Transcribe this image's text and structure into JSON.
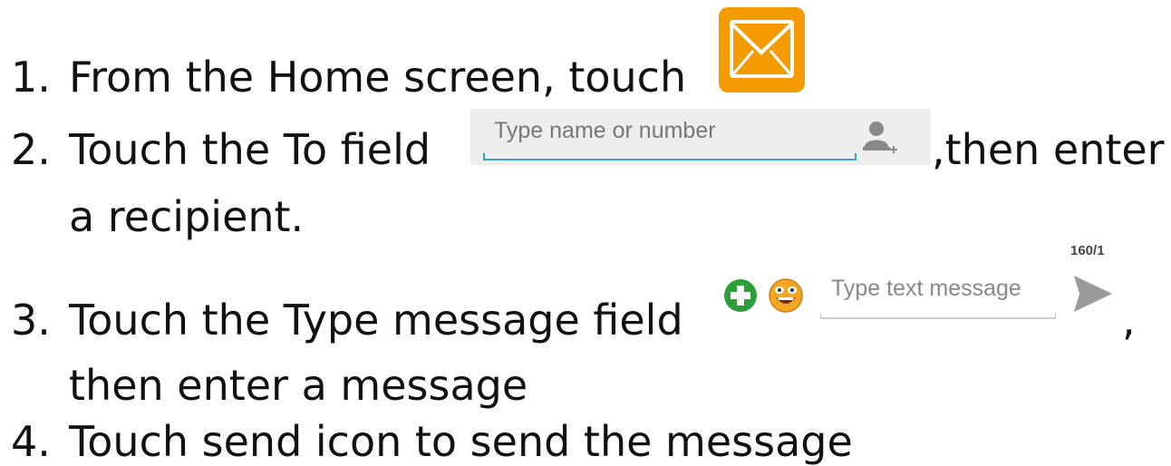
{
  "steps": [
    {
      "number": "1.",
      "text": "From the Home screen, touch"
    },
    {
      "number": "2.",
      "text": "Touch the To field",
      "suffix": ",then enter",
      "continuation": "a recipient."
    },
    {
      "number": "3.",
      "text": "Touch the Type message field",
      "suffix": ",",
      "continuation": "then enter a message"
    },
    {
      "number": "4.",
      "text": "Touch send icon to send the message"
    }
  ],
  "to_field": {
    "placeholder": "Type name or number",
    "icon": "add-contact-icon"
  },
  "compose": {
    "counter": "160/1",
    "placeholder": "Type text message",
    "icons": [
      "add-attachment-icon",
      "emoji-icon",
      "send-icon"
    ]
  },
  "icons": {
    "email": "email-icon"
  },
  "colors": {
    "email_icon_bg": "#f39b00",
    "field_underline": "#3aa3c9",
    "add_green": "#2e9e3a"
  }
}
